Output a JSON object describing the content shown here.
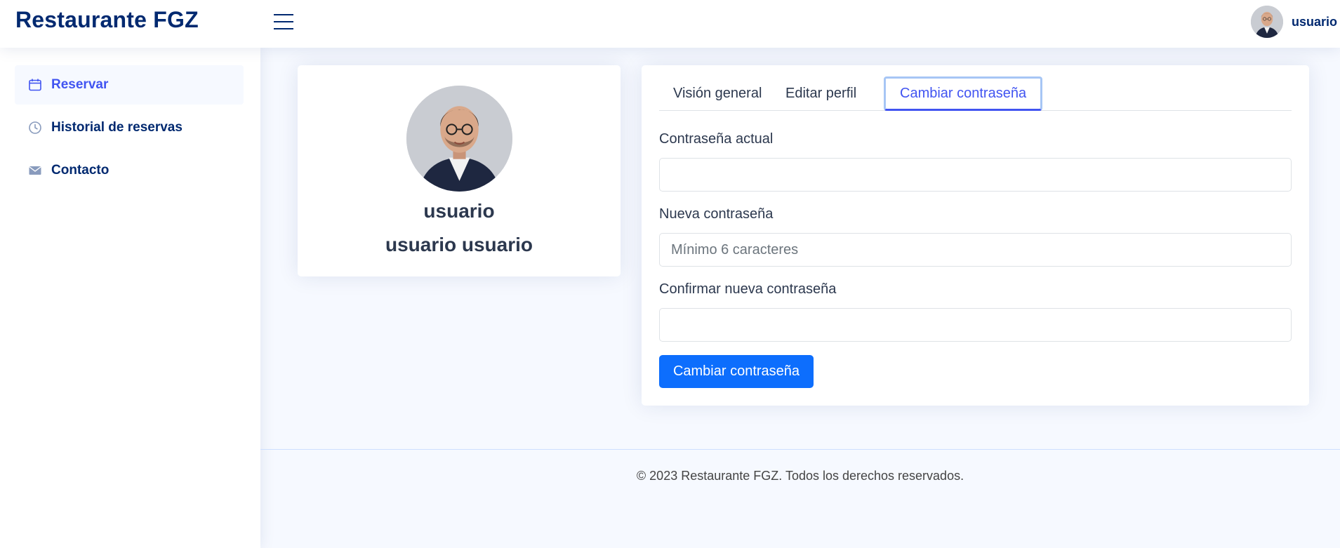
{
  "header": {
    "brand": "Restaurante FGZ",
    "user": {
      "name": "usuario",
      "caret": "▾"
    }
  },
  "sidebar": {
    "items": [
      {
        "label": "Reservar",
        "icon": "calendar-icon",
        "active": true
      },
      {
        "label": "Historial de reservas",
        "icon": "clock-icon",
        "active": false
      },
      {
        "label": "Contacto",
        "icon": "envelope-icon",
        "active": false
      }
    ]
  },
  "profile": {
    "username": "usuario",
    "full_name": "usuario usuario"
  },
  "tabs": {
    "items": [
      {
        "label": "Visión general",
        "active": false
      },
      {
        "label": "Editar perfil",
        "active": false
      },
      {
        "label": "Cambiar contraseña",
        "active": true
      }
    ]
  },
  "form": {
    "current_password": {
      "label": "Contraseña actual",
      "value": "",
      "placeholder": ""
    },
    "new_password": {
      "label": "Nueva contraseña",
      "value": "",
      "placeholder": "Mínimo 6 caracteres"
    },
    "confirm_password": {
      "label": "Confirmar nueva contraseña",
      "value": "",
      "placeholder": ""
    },
    "submit_label": "Cambiar contraseña"
  },
  "footer": {
    "copyright": "© 2023 Restaurante FGZ. Todos los derechos reservados."
  },
  "colors": {
    "brand": "#012970",
    "accent": "#4154f1",
    "primary_button": "#0d6efd",
    "background": "#f6f9ff"
  }
}
